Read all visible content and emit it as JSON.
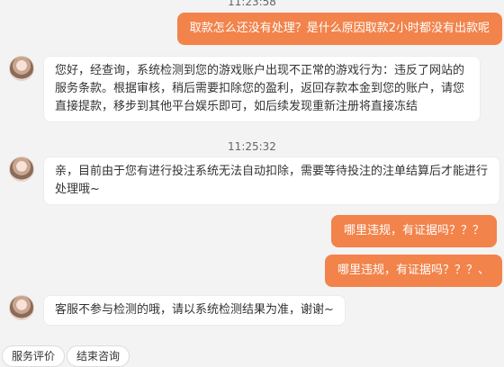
{
  "messages": [
    {
      "type": "timestamp",
      "text": "11:23:58"
    },
    {
      "type": "user",
      "text": "取款怎么还没有处理？是什么原因取款2小时都没有出款呢"
    },
    {
      "type": "agent",
      "text": "您好，经查询，系统检测到您的游戏账户出现不正常的游戏行为：违反了网站的服务条款。根据审核，稍后需要扣除您的盈利，返回存款本金到您的账户，请您直接提款，移步到其他平台娱乐即可，如后续发现重新注册将直接冻结"
    },
    {
      "type": "timestamp",
      "text": "11:25:32"
    },
    {
      "type": "agent",
      "text": "亲，目前由于您有进行投注系统无法自动扣除，需要等待投注的注单结算后才能进行处理哦~"
    },
    {
      "type": "user",
      "text": "哪里违规，有证据吗？？？"
    },
    {
      "type": "user",
      "text": "哪里违规，有证据吗？？？、"
    },
    {
      "type": "agent",
      "text": "客服不参与检测的哦，请以系统检测结果为准，谢谢~"
    }
  ],
  "quick_actions": {
    "rate_service": "服务评价",
    "end_chat": "结束咨询"
  },
  "colors": {
    "user_bubble": "#f2834b",
    "agent_bubble": "#ffffff",
    "background": "#f3f3f3"
  }
}
